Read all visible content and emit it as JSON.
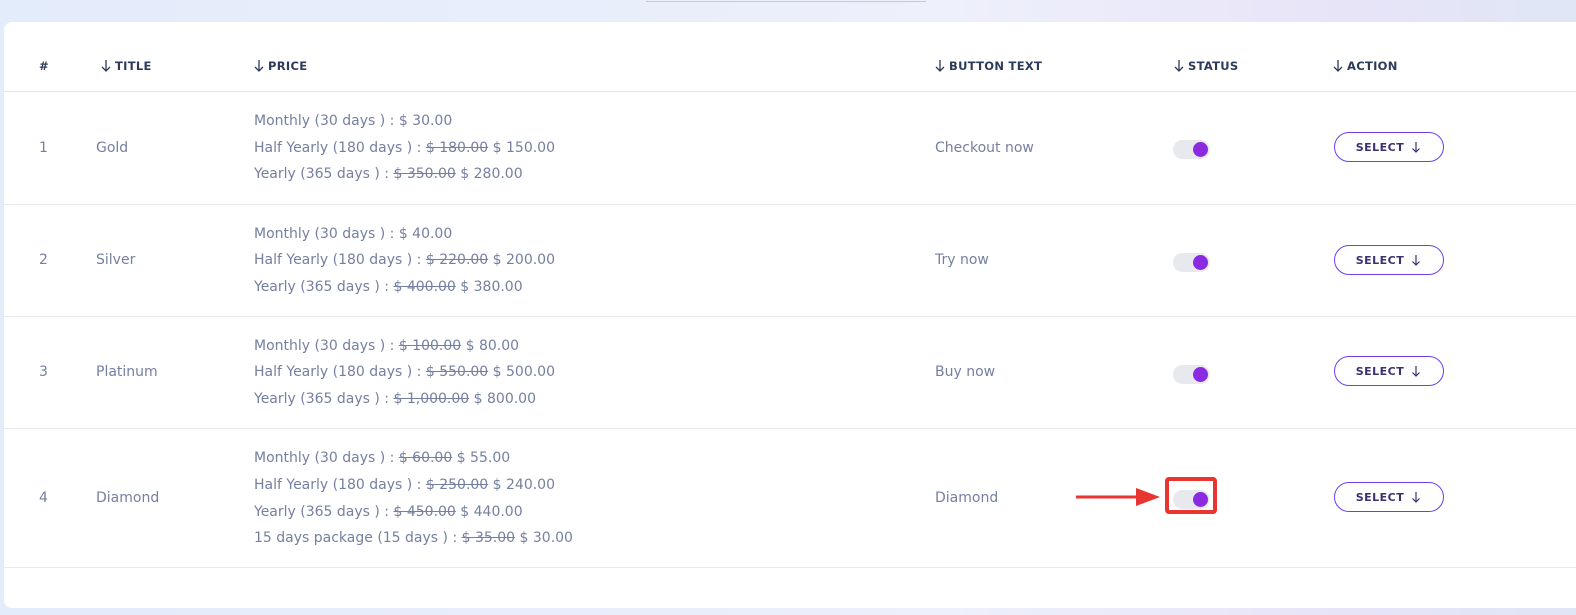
{
  "table": {
    "headers": {
      "number": "#",
      "title": "TITLE",
      "price": "PRICE",
      "button_text": "BUTTON TEXT",
      "status": "STATUS",
      "action": "ACTION"
    },
    "rows": [
      {
        "number": "1",
        "title": "Gold",
        "prices": [
          {
            "label": "Monthly (30 days ) :",
            "old": "",
            "current": "$ 30.00"
          },
          {
            "label": "Half Yearly (180 days ) :",
            "old": "$ 180.00",
            "current": "$ 150.00"
          },
          {
            "label": "Yearly (365 days ) :",
            "old": "$ 350.00",
            "current": "$ 280.00"
          }
        ],
        "button_text": "Checkout now",
        "status_on": true,
        "action_label": "SELECT"
      },
      {
        "number": "2",
        "title": "Silver",
        "prices": [
          {
            "label": "Monthly (30 days ) :",
            "old": "",
            "current": "$ 40.00"
          },
          {
            "label": "Half Yearly (180 days ) :",
            "old": "$ 220.00",
            "current": "$ 200.00"
          },
          {
            "label": "Yearly (365 days ) :",
            "old": "$ 400.00",
            "current": "$ 380.00"
          }
        ],
        "button_text": "Try now",
        "status_on": true,
        "action_label": "SELECT"
      },
      {
        "number": "3",
        "title": "Platinum",
        "prices": [
          {
            "label": "Monthly (30 days ) :",
            "old": "$ 100.00",
            "current": "$ 80.00"
          },
          {
            "label": "Half Yearly (180 days ) :",
            "old": "$ 550.00",
            "current": "$ 500.00"
          },
          {
            "label": "Yearly (365 days ) :",
            "old": "$ 1,000.00",
            "current": "$ 800.00"
          }
        ],
        "button_text": "Buy now",
        "status_on": true,
        "action_label": "SELECT"
      },
      {
        "number": "4",
        "title": "Diamond",
        "prices": [
          {
            "label": "Monthly (30 days ) :",
            "old": "$ 60.00",
            "current": "$ 55.00"
          },
          {
            "label": "Half Yearly (180 days ) :",
            "old": "$ 250.00",
            "current": "$ 240.00"
          },
          {
            "label": "Yearly (365 days ) :",
            "old": "$ 450.00",
            "current": "$ 440.00"
          },
          {
            "label": "15 days package (15 days ) :",
            "old": "$ 35.00",
            "current": "$ 30.00"
          }
        ],
        "button_text": "Diamond",
        "status_on": true,
        "action_label": "SELECT"
      }
    ]
  },
  "colors": {
    "accent": "#8a2be2",
    "button_border": "#6e3df0",
    "annotation": "#e8352f",
    "text_muted": "#7580a0",
    "header_text": "#2d3b5a"
  },
  "icons": {
    "sort": "arrow-down-icon",
    "action": "arrow-down-icon",
    "annotation": "red-arrow-right-icon"
  }
}
